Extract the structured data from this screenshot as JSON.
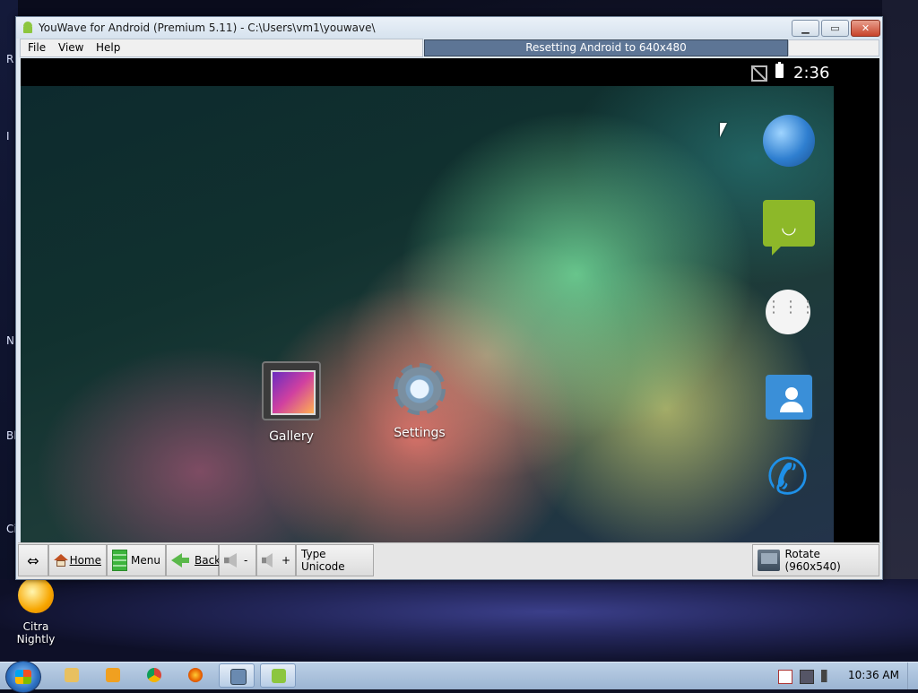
{
  "desktop": {
    "edge_letters": [
      "R",
      "I",
      "N",
      "Bl",
      "Ci"
    ],
    "icons": [
      {
        "label": "Citra Nightly",
        "icon": "citra-icon"
      }
    ]
  },
  "window": {
    "title": "YouWave for Android (Premium 5.11) - C:\\Users\\vm1\\youwave\\",
    "controls": {
      "minimize": "minimize-icon",
      "maximize": "maximize-icon",
      "close": "close-icon"
    },
    "menu": [
      {
        "label": "File",
        "accel": "F"
      },
      {
        "label": "View",
        "accel": "V"
      },
      {
        "label": "Help",
        "accel": "H"
      }
    ],
    "progress": {
      "text": "Resetting Android to 640x480",
      "fraction": 1.0
    }
  },
  "android": {
    "status": {
      "clock": "2:36",
      "icons": [
        "no-sim-icon",
        "battery-icon"
      ]
    },
    "home_icons": [
      {
        "label": "Gallery",
        "icon": "gallery-icon"
      },
      {
        "label": "Settings",
        "icon": "settings-gear-icon"
      }
    ],
    "hotseat": [
      {
        "name": "browser",
        "icon": "globe-icon"
      },
      {
        "name": "messaging",
        "icon": "sms-icon"
      },
      {
        "name": "all-apps",
        "icon": "app-drawer-icon"
      },
      {
        "name": "contacts",
        "icon": "contacts-icon"
      },
      {
        "name": "phone",
        "icon": "phone-icon"
      }
    ]
  },
  "toolbar": {
    "resize_label": "⇔",
    "home_label": "Home",
    "menu_label": "Menu",
    "back_label": "Back",
    "vol_down_label": "-",
    "vol_up_label": "+",
    "unicode_label": "Type Unicode",
    "rotate_label": "Rotate (960x540)"
  },
  "taskbar": {
    "apps": [
      "explorer-icon",
      "media-player-icon",
      "chrome-icon",
      "firefox-icon",
      "remote-icon",
      "youwave-icon"
    ],
    "time": "10:36 AM",
    "tray_icons": [
      "action-center-icon",
      "network-icon",
      "volume-icon"
    ]
  }
}
